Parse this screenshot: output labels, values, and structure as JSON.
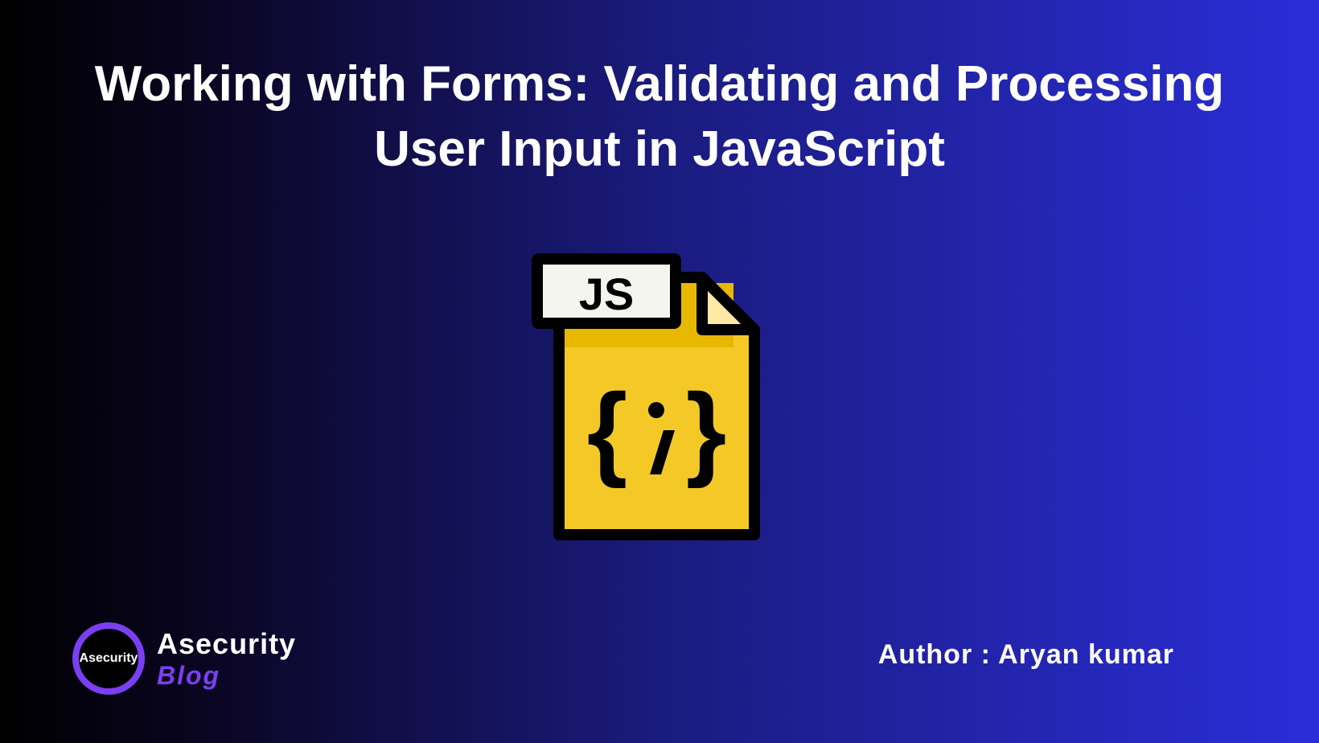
{
  "title": "Working with Forms: Validating and Processing User Input in JavaScript",
  "icon": {
    "label": "JS",
    "symbol_left": "{",
    "symbol_right": "}",
    "symbol_center": "i"
  },
  "logo": {
    "circle_text": "Asecurity",
    "text_top": "Asecurity",
    "text_bottom": "Blog"
  },
  "author": "Author : Aryan kumar",
  "colors": {
    "background_start": "#000000",
    "background_end": "#2b2dd8",
    "accent": "#7b3ff2",
    "icon_yellow": "#f4c827",
    "icon_light_yellow": "#ffe8a3",
    "icon_white": "#f5f5f0"
  }
}
